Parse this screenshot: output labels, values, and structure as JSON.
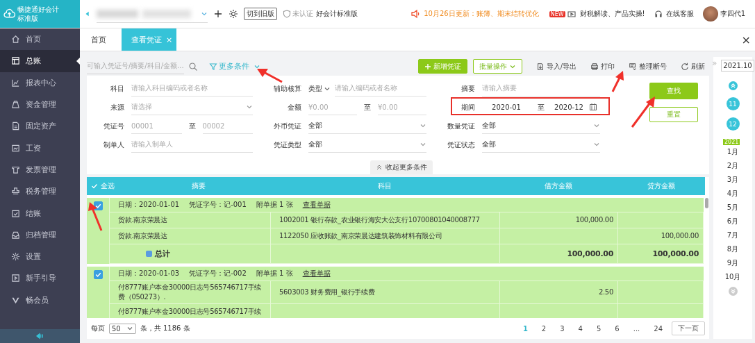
{
  "app": {
    "logo": "畅捷通好会计",
    "edition": "标准版"
  },
  "topbar": {
    "switch_button": "切到旧版",
    "auth_badge": "未认证",
    "product": "好会计标准版",
    "notice": "10月26日更新：账簿、期末结转优化",
    "news_badge": "NEW",
    "news": "财税解读、产品实操!",
    "support": "在线客服",
    "user": "李四代1"
  },
  "sidebar": {
    "items": [
      {
        "label": "首页",
        "selected": false
      },
      {
        "label": "总账",
        "selected": true
      },
      {
        "label": "报表中心",
        "selected": false
      },
      {
        "label": "资金管理",
        "selected": false
      },
      {
        "label": "固定资产",
        "selected": false
      },
      {
        "label": "工资",
        "selected": false
      },
      {
        "label": "发票管理",
        "selected": false
      },
      {
        "label": "税务管理",
        "selected": false
      },
      {
        "label": "结账",
        "selected": false
      },
      {
        "label": "归档管理",
        "selected": false
      },
      {
        "label": "设置",
        "selected": false
      },
      {
        "label": "新手引导",
        "selected": false
      },
      {
        "label": "畅会员",
        "selected": false
      }
    ]
  },
  "tabs": [
    {
      "label": "首页",
      "selected": false
    },
    {
      "label": "查看凭证",
      "selected": true,
      "close": "×"
    }
  ],
  "tabs_close": "×",
  "toolbar": {
    "search_placeholder": "可输入凭证号/摘要/科目/金额...",
    "more_filters": "更多条件",
    "buttons": [
      {
        "label": "新增凭证",
        "kind": "primary"
      },
      {
        "label": "批量操作",
        "kind": "outline"
      },
      {
        "label": "导入/导出",
        "kind": "text"
      },
      {
        "label": "打印",
        "kind": "text"
      },
      {
        "label": "整理断号",
        "kind": "text"
      },
      {
        "label": "刷新",
        "kind": "text"
      }
    ]
  },
  "filters": [
    {
      "label": "科目",
      "kind": "text",
      "placeholder": "请输入科目编码或者名称"
    },
    {
      "label": "辅助核算",
      "kind": "aux",
      "type": "类型",
      "placeholder": "请输入编码或者名称"
    },
    {
      "label": "摘要",
      "kind": "text",
      "placeholder": "请输入摘要"
    },
    {
      "label": "来源",
      "kind": "select",
      "placeholder": "请选择"
    },
    {
      "label": "金额",
      "kind": "range",
      "from_placeholder": "¥0.00",
      "separator": "至",
      "to_placeholder": "¥0.00"
    },
    {
      "label": "期间",
      "kind": "date_range",
      "from_value": "2020-01",
      "separator": "至",
      "to_value": "2020-12"
    },
    {
      "label": "凭证号",
      "kind": "range",
      "from_placeholder": "00001",
      "separator": "至",
      "to_placeholder": "00002"
    },
    {
      "label": "外币凭证",
      "kind": "select",
      "value": "全部"
    },
    {
      "label": "数量凭证",
      "kind": "select",
      "value": "全部"
    },
    {
      "label": "制单人",
      "kind": "text",
      "placeholder": "请输入制单人"
    },
    {
      "label": "凭证类型",
      "kind": "select",
      "value": "全部"
    },
    {
      "label": "凭证状态",
      "kind": "select",
      "value": "全部"
    }
  ],
  "filter_buttons": {
    "search": "查找",
    "reset": "重置",
    "collapse": "收起更多条件"
  },
  "table": {
    "select_all": "全选",
    "select_all_checked": true,
    "columns": [
      "摘要",
      "科目",
      "借方金额",
      "贷方金额"
    ],
    "vouchers": [
      {
        "checked": true,
        "date": "日期：2020-01-01",
        "number": "凭证字号：记-001",
        "attachments": "附单据 1 张",
        "view_link": "查看单据",
        "lines": [
          {
            "summary": "货款.南京荣晨达",
            "account": "1002001 银行存款_农业银行海安大公支行10700801040008777",
            "debit": "100,000.00"
          },
          {
            "summary": "货款.南京荣晨达",
            "account": "1122050 应收账款_南京荣晨达建筑装饰材料有限公司",
            "credit": "100,000.00"
          }
        ],
        "total": {
          "label": "总计",
          "debit": "100,000.00",
          "credit": "100,000.00"
        }
      },
      {
        "checked": true,
        "date": "日期：2020-01-03",
        "number": "凭证字号：记-002",
        "attachments": "附单据 1 张",
        "view_link": "查看单据",
        "lines": [
          {
            "summary": "付8777账户本金30000日志号565746717手续费（050273）.",
            "account": "5603003 财务费用_银行手续费",
            "debit": "2.50"
          },
          {
            "summary": "付8777账户本金30000日志号565746717手续"
          }
        ]
      }
    ]
  },
  "pagination": {
    "per_page_label": "每页",
    "per_page": "50",
    "total": "条，共 1186 条",
    "pages": [
      {
        "label": "1",
        "selected": true
      },
      {
        "label": "2",
        "selected": false
      },
      {
        "label": "3",
        "selected": false
      },
      {
        "label": "4",
        "selected": false
      },
      {
        "label": "5",
        "selected": false
      },
      {
        "label": "6",
        "selected": false
      },
      {
        "label": "...",
        "selected": false
      },
      {
        "label": "24",
        "selected": false
      }
    ],
    "next": "下一页"
  },
  "calendar": {
    "expand": "»",
    "period": "2021.10",
    "prior_months": [
      "11",
      "12"
    ],
    "year": "2021",
    "months": [
      "1月",
      "2月",
      "3月",
      "4月",
      "5月",
      "6月",
      "7月",
      "8月",
      "9月",
      "10月"
    ]
  }
}
